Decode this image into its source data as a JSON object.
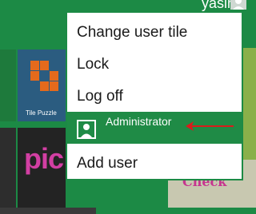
{
  "header": {
    "user_name": "yasir"
  },
  "tiles": {
    "tile_puzzle_label": "Tile Puzzle",
    "pic_text": "pic",
    "check_text": "Check"
  },
  "menu": {
    "items": [
      {
        "label": "Change user tile"
      },
      {
        "label": "Lock"
      },
      {
        "label": "Log off"
      },
      {
        "label": "Administrator"
      },
      {
        "label": "Add user"
      }
    ]
  },
  "colors": {
    "accent": "#1c8a45",
    "arrow": "#d81c1c"
  }
}
